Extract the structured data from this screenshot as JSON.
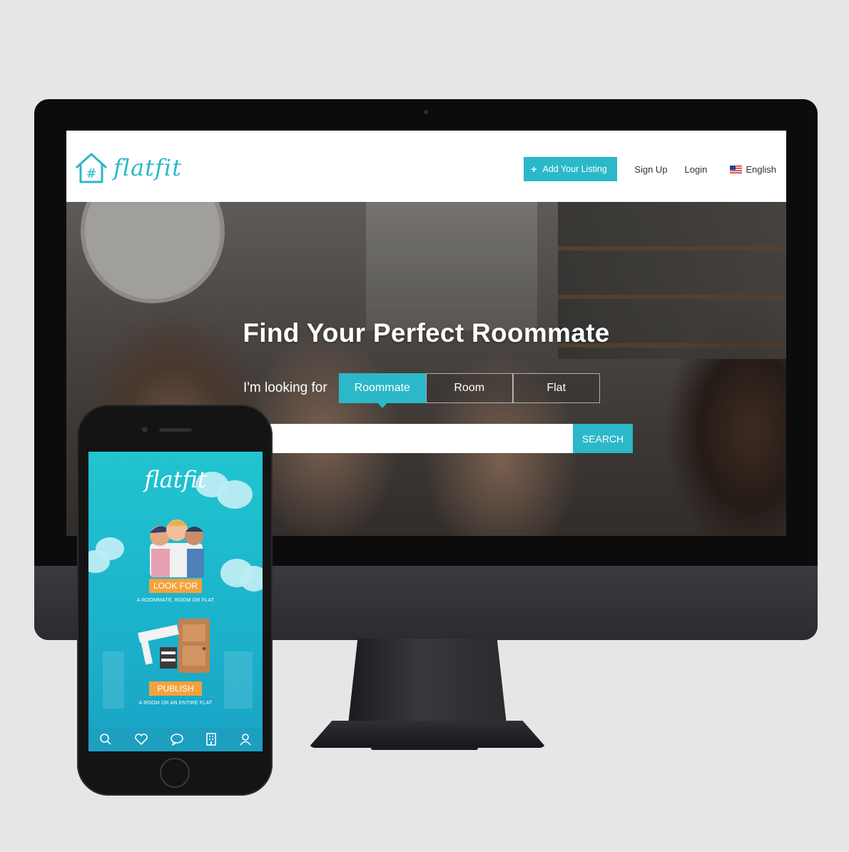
{
  "website": {
    "logo_text": "flatfit",
    "nav": {
      "add_listing": "Add Your Listing",
      "sign_up": "Sign Up",
      "login": "Login",
      "language": "English"
    },
    "hero": {
      "title": "Find Your Perfect Roommate",
      "looking_label": "I'm looking for",
      "options": [
        "Roommate",
        "Room",
        "Flat"
      ],
      "selected_option": "Roommate",
      "search_value": "",
      "search_button": "SEARCH"
    },
    "colors": {
      "accent": "#2bb8c9"
    }
  },
  "mobile_app": {
    "logo_text": "flatfit",
    "look_for": {
      "badge": "LOOK FOR",
      "subtitle": "A ROOMMATE, ROOM OR FLAT"
    },
    "publish": {
      "badge": "PUBLISH",
      "subtitle": "A ROOM OR AN ENTIRE FLAT"
    },
    "nav_icons": [
      "search-icon",
      "heart-icon",
      "chat-icon",
      "building-icon",
      "user-icon"
    ],
    "colors": {
      "background": "#1cb3cc",
      "badge": "#f4a23c"
    }
  }
}
